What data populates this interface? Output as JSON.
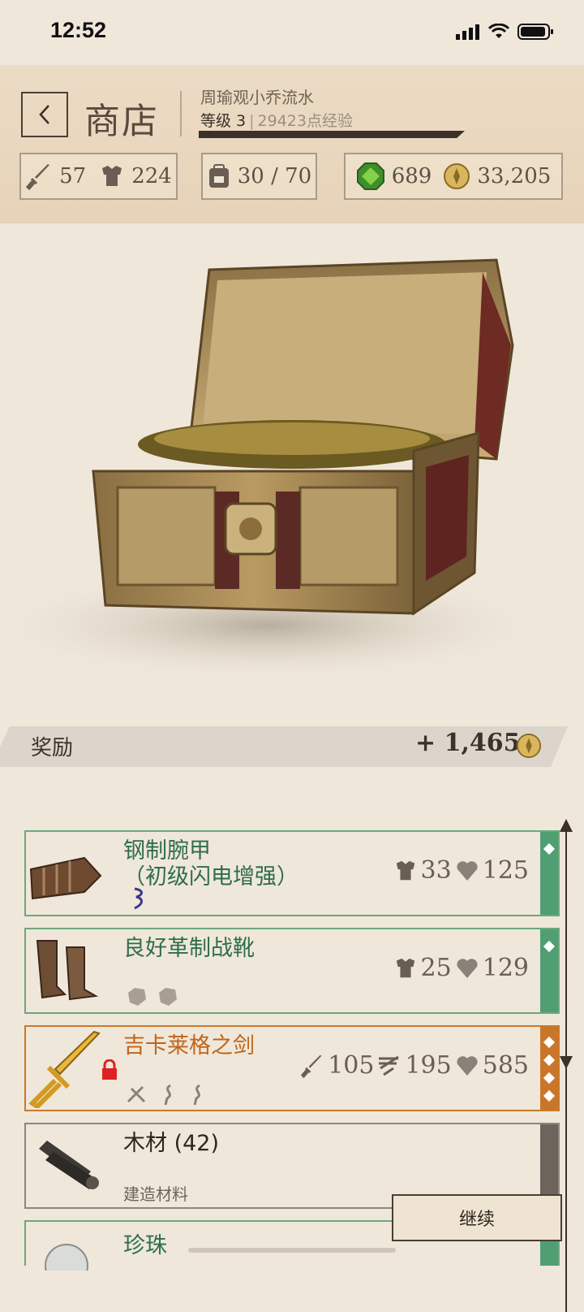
{
  "status_bar": {
    "time": "12:52"
  },
  "header": {
    "back_label": "<",
    "title": "商店",
    "player_name": "周瑜观小乔流水",
    "level": "等级 3",
    "xp_text": "29423点经验",
    "xp_progress": 0.85
  },
  "stats": {
    "attack": "57",
    "armor": "224",
    "carry": "30 / 70",
    "gems": "689",
    "gold": "33,205"
  },
  "reward": {
    "label": "奖励",
    "value": "+ 1,465"
  },
  "items": [
    {
      "name": "钢制腕甲\n（初级闪电增强）",
      "armor": "33",
      "value": "125",
      "rarity": "green"
    },
    {
      "name": "良好革制战靴",
      "armor": "25",
      "value": "129",
      "rarity": "green"
    },
    {
      "name": "吉卡莱格之剑",
      "attack": "105",
      "stagger": "195",
      "value": "585",
      "rarity": "orange"
    },
    {
      "name": "木材 (42)",
      "subtitle": "建造材料",
      "rarity": "gray"
    },
    {
      "name": "珍珠",
      "rarity": "green"
    }
  ],
  "continue_label": "继续",
  "colors": {
    "accent_green": "#4f9f73",
    "accent_orange": "#c9762b",
    "xp_bar": "#3b302a"
  }
}
